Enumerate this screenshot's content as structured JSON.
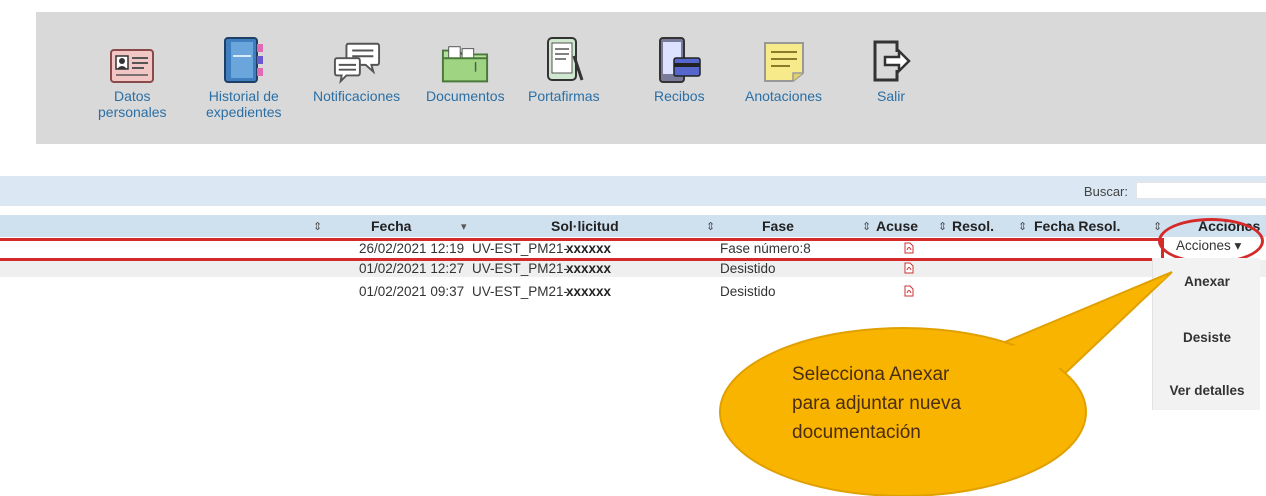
{
  "toolbar": {
    "items": [
      {
        "name": "datos-personales",
        "label": "Datos\npersonales",
        "icon": "id-card-icon"
      },
      {
        "name": "historial-expedientes",
        "label": "Historial de\nexpedientes",
        "icon": "binder-icon"
      },
      {
        "name": "notificaciones",
        "label": "Notificaciones",
        "icon": "speech-bubbles-icon"
      },
      {
        "name": "documentos",
        "label": "Documentos",
        "icon": "folder-icon"
      },
      {
        "name": "portafirmas",
        "label": "Portafirmas",
        "icon": "tablet-pen-icon"
      },
      {
        "name": "recibos",
        "label": "Recibos",
        "icon": "phone-card-icon"
      },
      {
        "name": "anotaciones",
        "label": "Anotaciones",
        "icon": "sticky-note-icon"
      },
      {
        "name": "salir",
        "label": "Salir",
        "icon": "exit-icon"
      }
    ]
  },
  "search": {
    "label": "Buscar:",
    "value": ""
  },
  "table": {
    "headers": {
      "fecha": "Fecha",
      "solicitud": "Sol·licitud",
      "fase": "Fase",
      "acuse": "Acuse",
      "resol": "Resol.",
      "fecha_resol": "Fecha Resol.",
      "acciones": "Acciones"
    },
    "sort_icons": {
      "both": "⇕",
      "desc": "▾"
    },
    "rows": [
      {
        "fecha": "26/02/2021 12:19",
        "solicitud_prefix": "UV-EST_PM21-",
        "solicitud_code": "xxxxxx",
        "fase": "Fase número:8",
        "acuse": "pdf-icon"
      },
      {
        "fecha": "01/02/2021 12:27",
        "solicitud_prefix": "UV-EST_PM21-",
        "solicitud_code": "xxxxxx",
        "fase": "Desistido",
        "acuse": "pdf-icon"
      },
      {
        "fecha": "01/02/2021 09:37",
        "solicitud_prefix": "UV-EST_PM21-",
        "solicitud_code": "xxxxxx",
        "fase": "Desistido",
        "acuse": "pdf-icon"
      }
    ]
  },
  "actions": {
    "button_label": "Acciones ▾",
    "options": [
      "Anexar",
      "Desiste",
      "Ver detalles"
    ]
  },
  "callout": {
    "lines": [
      "Selecciona Anexar",
      "para adjuntar nueva",
      "documentación"
    ],
    "fill": "#f9b400",
    "stroke": "#e0a000"
  },
  "highlight_color": "#d52a2a"
}
